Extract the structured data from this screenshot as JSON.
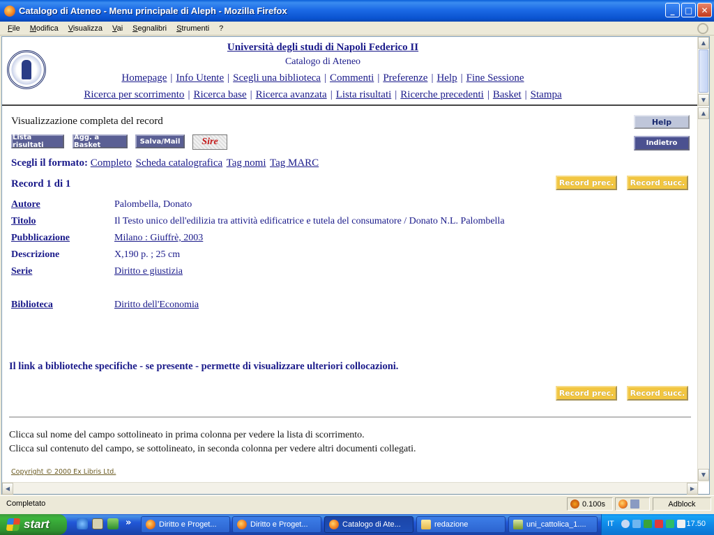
{
  "window": {
    "title": "Catalogo di Ateneo - Menu principale di Aleph - Mozilla Firefox",
    "minimize": "_",
    "maximize": "□",
    "close": "✕"
  },
  "menubar": {
    "items": [
      "File",
      "Modifica",
      "Visualizza",
      "Vai",
      "Segnalibri",
      "Strumenti",
      "?"
    ]
  },
  "header": {
    "university": "Università degli studi di Napoli Federico II",
    "catalog": "Catalogo di Ateneo",
    "nav1": [
      "Homepage",
      "Info Utente",
      "Scegli una biblioteca",
      "Commenti",
      "Preferenze",
      "Help",
      "Fine Sessione"
    ],
    "nav2": [
      "Ricerca per scorrimento",
      "Ricerca base",
      "Ricerca avanzata",
      "Lista risultati",
      "Ricerche precedenti",
      "Basket",
      "Stampa"
    ],
    "separator": "|"
  },
  "record_page": {
    "title": "Visualizzazione completa del record",
    "buttons": {
      "lista_risultati": "Lista risultati",
      "agg_basket": "Agg. a Basket",
      "salva_mail": "Salva/Mail",
      "sire": "Sire",
      "help": "Help",
      "indietro": "Indietro",
      "record_prec": "Record prec.",
      "record_succ": "Record succ."
    },
    "format": {
      "label": "Scegli il formato:",
      "options": [
        "Completo",
        "Scheda catalografica",
        "Tag nomi",
        "Tag MARC"
      ]
    },
    "record_count": "Record 1 di 1",
    "fields": [
      {
        "label": "Autore",
        "value": "Palombella, Donato"
      },
      {
        "label": "Titolo",
        "value": "Il Testo unico dell'edilizia tra attività edificatrice e tutela del consumatore / Donato N.L. Palombella"
      },
      {
        "label": "Pubblicazione",
        "value": "Milano : Giuffrè, 2003"
      },
      {
        "label": "Descrizione",
        "value": "X,190 p. ; 25 cm"
      },
      {
        "label": "Serie",
        "value": "Diritto e giustizia"
      },
      {
        "label": "Biblioteca",
        "value": "Diritto dell'Economia"
      }
    ],
    "note": "Il link a biblioteche specifiche - se presente - permette di visualizzare ulteriori collocazioni.",
    "info1": "Clicca sul nome del campo sottolineato in prima colonna per vedere la lista di scorrimento.",
    "info2": "Clicca sul contenuto del campo, se sottolineato, in seconda colonna per vedere altri documenti collegati.",
    "copyright": "Copyright © 2000 Ex Libris Ltd."
  },
  "statusbar": {
    "text": "Completato",
    "timing": "0.100s",
    "adblock": "Adblock"
  },
  "taskbar": {
    "start": "start",
    "tasks": [
      "Diritto e Proget...",
      "Diritto e Proget...",
      "Catalogo di Ate...",
      "redazione",
      "uni_cattolica_1...."
    ],
    "language": "IT",
    "clock": "17.50",
    "overflow": "»"
  },
  "colors": {
    "link": "#1a1a8a",
    "title_bar": "#1c6ae6",
    "record_nav_button": "#f2c641",
    "dark_button": "#5a5f94"
  }
}
